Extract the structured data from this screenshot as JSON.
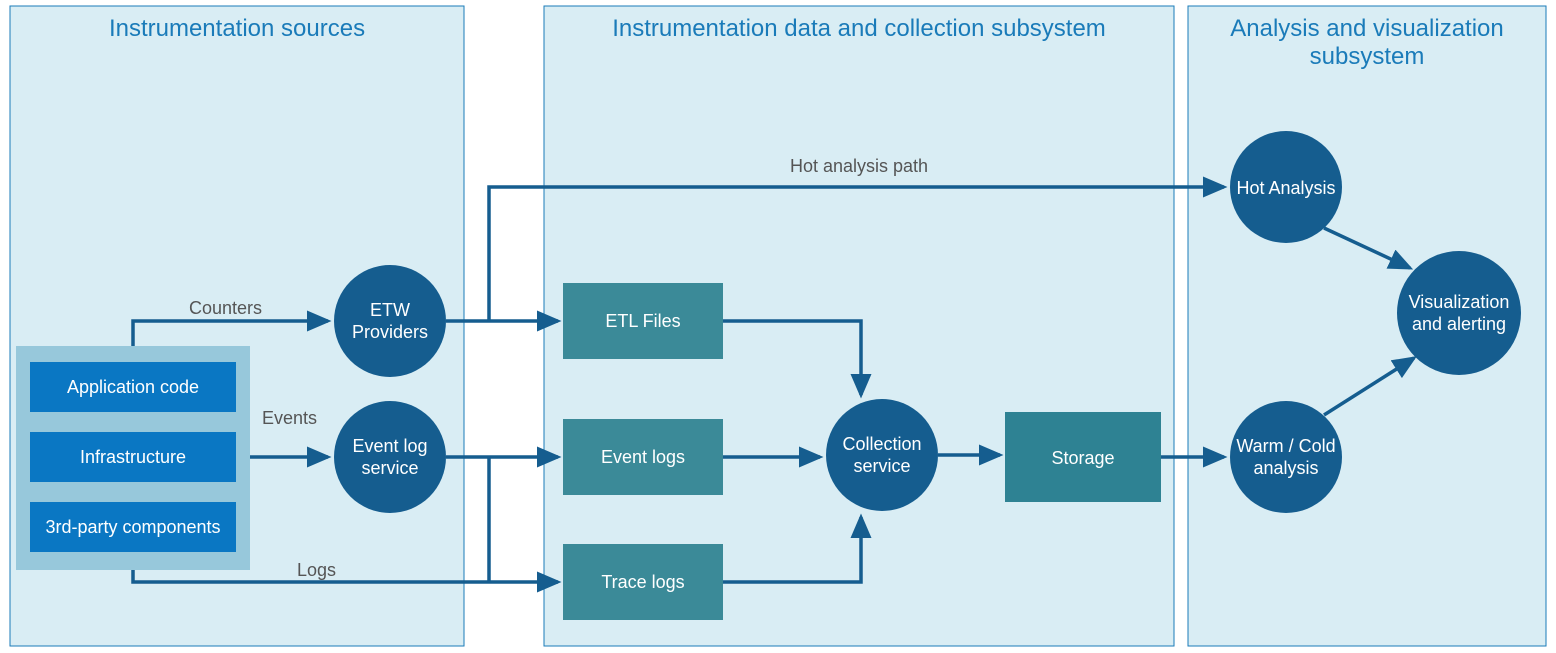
{
  "panels": {
    "sources": {
      "title": "Instrumentation sources"
    },
    "collection": {
      "title": "Instrumentation data and collection subsystem"
    },
    "analysis": {
      "title_line1": "Analysis and visualization",
      "title_line2": "subsystem"
    }
  },
  "sources_group": {
    "app_code": "Application code",
    "infrastructure": "Infrastructure",
    "third_party": "3rd-party components"
  },
  "source_nodes": {
    "etw": {
      "line1": "ETW",
      "line2": "Providers"
    },
    "event_log": {
      "line1": "Event log",
      "line2": "service"
    }
  },
  "collection_nodes": {
    "etl_files": "ETL Files",
    "event_logs": "Event logs",
    "trace_logs": "Trace logs",
    "collection_service": {
      "line1": "Collection",
      "line2": "service"
    },
    "storage": "Storage"
  },
  "analysis_nodes": {
    "hot": "Hot Analysis",
    "warm_cold": {
      "line1": "Warm / Cold",
      "line2": "analysis"
    },
    "viz": {
      "line1": "Visualization",
      "line2": "and alerting"
    }
  },
  "edge_labels": {
    "counters": "Counters",
    "events": "Events",
    "logs": "Logs",
    "hot_path": "Hot analysis path"
  },
  "colors": {
    "panel_bg": "#d9edf4",
    "panel_border": "#1a7bb9",
    "group_bg": "#97c8db",
    "group_item": "#0a77c3",
    "circle": "#155d8f",
    "teal_rect": "#3b8a98",
    "storage": "#2e8293",
    "arrow": "#155d8f"
  }
}
